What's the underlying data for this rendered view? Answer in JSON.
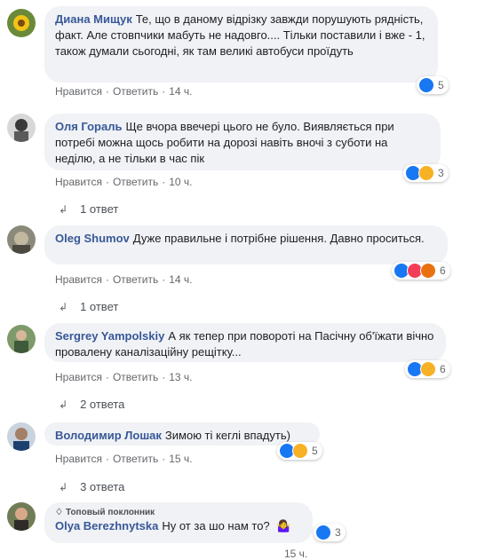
{
  "comments": [
    {
      "author": "Диана Мищук",
      "text": "Те, що в даному відрізку завжди порушують рядність, факт. Але стовпчики мабуть не надовго.... Тільки поставили і вже - 1, також думали сьогодні, як там великі автобуси проїдуть",
      "like": "Нравится",
      "reply": "Ответить",
      "time": "14 ч.",
      "reactions_count": "5",
      "reactions": [
        "like-icon"
      ]
    },
    {
      "author": "Оля Гораль",
      "text": "Ще вчора ввечері цього не було. Виявляється при потребі можна щось робити на дорозі навіть вночі з суботи на неділю, а не тільки в час пік",
      "like": "Нравится",
      "reply": "Ответить",
      "time": "10 ч.",
      "reactions_count": "3",
      "reactions": [
        "like-icon",
        "haha-icon"
      ],
      "replies": "1 ответ"
    },
    {
      "author": "Oleg Shumov",
      "text": "Дуже правильне і потрібне рішення. Давно проситься.",
      "like": "Нравится",
      "reply": "Ответить",
      "time": "14 ч.",
      "reactions_count": "6",
      "reactions": [
        "like-icon",
        "love-icon",
        "angry-icon"
      ],
      "replies": "1 ответ"
    },
    {
      "author": "Sergrey Yampolskiy",
      "text": "А як тепер при повороті на Пасічну об'їжати вічно провалену каналізаційну рещітку...",
      "like": "Нравится",
      "reply": "Ответить",
      "time": "13 ч.",
      "reactions_count": "6",
      "reactions": [
        "like-icon",
        "wow-icon"
      ],
      "replies": "2 ответа"
    },
    {
      "author": "Володимир Лошак",
      "text": "Зимою ті кеглі впадуть)",
      "like": "Нравится",
      "reply": "Ответить",
      "time": "15 ч.",
      "reactions_count": "5",
      "reactions": [
        "like-icon",
        "haha-icon"
      ],
      "replies": "3 ответа"
    },
    {
      "badge": "Топовый поклонник",
      "author": "Olya Berezhnytska",
      "text": "Ну от за шо нам то?",
      "emoji": "🤷‍♀️",
      "reactions_count": "3",
      "reactions": [
        "like-icon"
      ],
      "time": "15 ч."
    }
  ],
  "colors": {
    "like": "#1877f2",
    "love": "#f33e58",
    "haha": "#f7b125",
    "angry": "#e9710f",
    "link": "#385898"
  }
}
